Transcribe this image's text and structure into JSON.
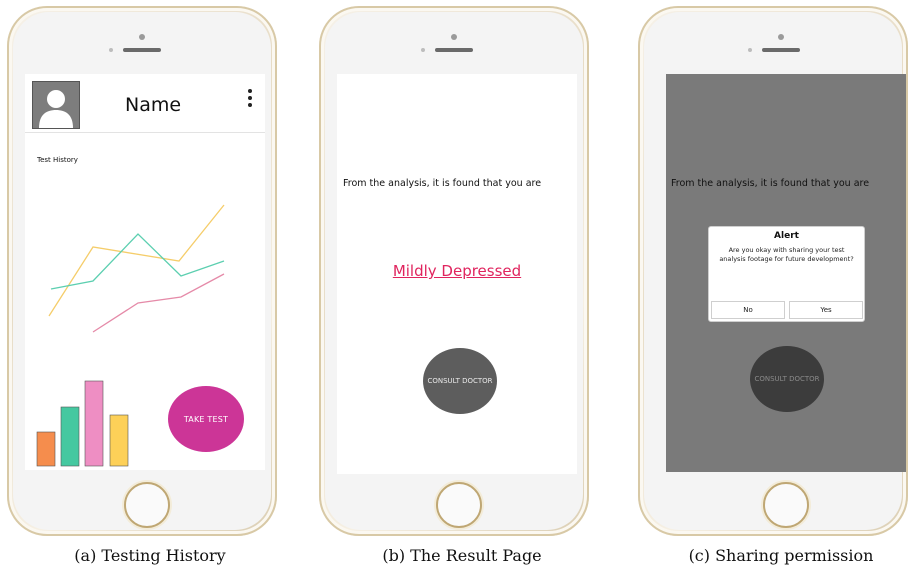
{
  "captions": {
    "a": "(a) Testing History",
    "b": "(b) The Result Page",
    "c": "(c) Sharing permission"
  },
  "screen_a": {
    "name": "Name",
    "history_label": "Test History",
    "take_test_label": "TAKE TEST",
    "icons": [
      "avatar-icon",
      "more-vertical-icon"
    ],
    "colors": {
      "take_test": "#cc3597",
      "line_yellow": "#f5cd6a",
      "line_teal": "#5ccfb0",
      "line_pink": "#e58aa8",
      "bar_orange": "#f58d4d",
      "bar_green": "#45c8a0",
      "bar_pink": "#ee8ec3",
      "bar_yellow": "#fdd058"
    }
  },
  "screen_b": {
    "result_text": "From the analysis, it is found that you are",
    "result_value": "Mildly Depressed",
    "consult_label": "CONSULT DOCTOR",
    "colors": {
      "result_value": "#e0245e",
      "consult": "#5d5d5d"
    }
  },
  "screen_c": {
    "result_text": "From the analysis, it is found that you are",
    "alert_title": "Alert",
    "alert_message": "Are you okay with sharing your test analysis footage for future development?",
    "no_label": "No",
    "yes_label": "Yes",
    "consult_label": "CONSULT DOCTOR",
    "colors": {
      "overlay": "#7a7a7a",
      "consult": "#3c3c3c"
    }
  }
}
